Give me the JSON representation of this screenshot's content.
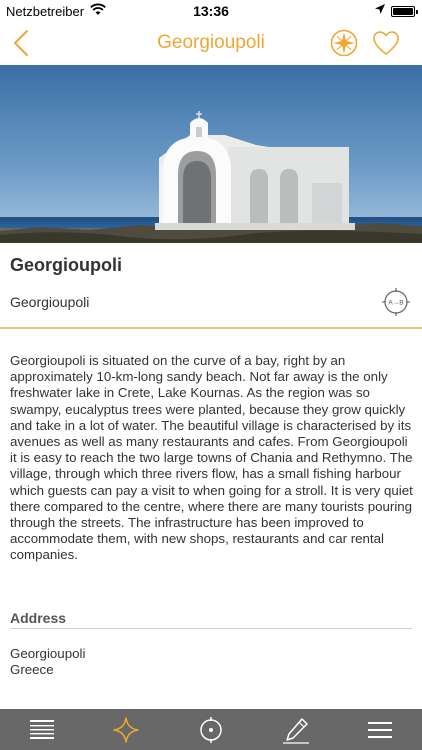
{
  "status_bar": {
    "carrier": "Netzbetreiber",
    "time": "13:36",
    "wifi_icon": "wifi-icon",
    "location_icon": "location-arrow-icon",
    "battery_level": 1.0
  },
  "nav": {
    "title": "Georgioupoli",
    "back_icon": "chevron-left-icon",
    "compass_icon": "compass-icon",
    "favorite_icon": "heart-outline-icon",
    "accent_color": "#f0a732"
  },
  "hero": {
    "subject": "white chapel by the sea"
  },
  "place": {
    "title": "Georgioupoli",
    "subtitle": "Georgioupoli",
    "route_icon_label": "A→B"
  },
  "description": "Georgioupoli is situated on the curve of a bay, right by an approximately 10-km-long sandy beach. Not far away is the only freshwater lake in Crete, Lake Kournas. As the region was so swampy, eucalyptus trees were planted, because they grow quickly and take in a lot of water. The beautiful village is characterised by its avenues as well as many restaurants and cafes. From Georgioupoli it is easy to reach the two large towns of Chania and Rethymno. The village, through which three rivers flow, has a small fishing harbour which guests can pay a visit to when going for a stroll. It is very quiet there compared to the centre, where there are many tourists pouring through the streets. The infrastructure has been improved to accommodate them, with new shops, restaurants and car rental companies.",
  "address": {
    "heading": "Address",
    "line1": "Georgioupoli",
    "line2": "Greece"
  },
  "tab_bar": {
    "background": "#686868",
    "active_color": "#f0a732",
    "tabs": [
      {
        "icon": "list-icon",
        "active": false
      },
      {
        "icon": "star-icon",
        "active": true
      },
      {
        "icon": "target-icon",
        "active": false
      },
      {
        "icon": "pencil-icon",
        "active": false
      },
      {
        "icon": "menu-icon",
        "active": false
      }
    ]
  }
}
